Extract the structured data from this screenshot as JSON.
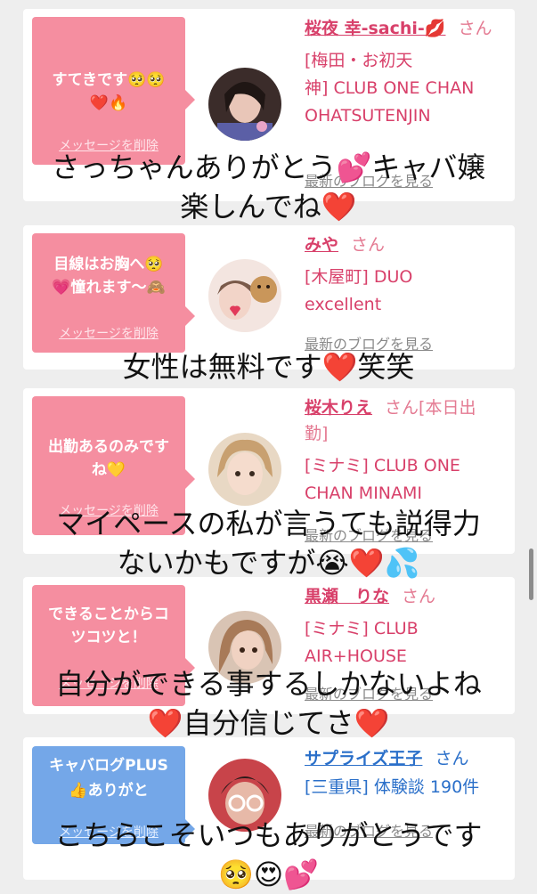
{
  "delete_label": "メッセージを削除",
  "san": "さん",
  "blog_label": "最新のブログを見る",
  "cards": [
    {
      "bubble_line1": "すてきです🥺🥺",
      "bubble_line2": "❤️🔥",
      "name": "桜夜 幸-sachi-💋",
      "name_extra": "",
      "shop_line1": "[梅田・お初天",
      "shop_line2": "神] CLUB ONE CHAN",
      "shop_line3": "OHATSUTENJIN"
    },
    {
      "bubble_line1": "目線はお胸へ🥺",
      "bubble_line2": "💗憧れます～🙈",
      "name": "みや",
      "name_extra": "",
      "shop_line1": "[木屋町] DUO",
      "shop_line2": "excellent",
      "shop_line3": ""
    },
    {
      "bubble_line1": "出勤あるのみです",
      "bubble_line2": "ね💛",
      "name": "桜木りえ",
      "name_extra": "[本日出",
      "name_extra2": "勤]",
      "shop_line1": "[ミナミ] CLUB ONE",
      "shop_line2": "CHAN MINAMI",
      "shop_line3": ""
    },
    {
      "bubble_line1": "できることからコ",
      "bubble_line2": "ツコツと！",
      "name": "黒瀬　りな",
      "name_extra": "",
      "shop_line1": "[ミナミ] CLUB",
      "shop_line2": "AIR+HOUSE",
      "shop_line3": ""
    },
    {
      "bubble_line1": "キャバログPLUS",
      "bubble_line2": "👍ありがと",
      "name": "サプライズ王子",
      "name_extra": "",
      "shop_line1": "[三重県] 体験談 190件",
      "shop_line2": "",
      "shop_line3": ""
    }
  ],
  "overlays": {
    "o1_line1": "さっちゃんありがとう💕キャバ嬢",
    "o1_line2": "楽しんでね❤️",
    "o2_line1": "女性は無料です❤️笑笑",
    "o3_line1": "マイペースの私が言うても説得力",
    "o3_line2": "ないかもですが😭❤️💦",
    "o4_line1": "自分ができる事するしかないよね",
    "o4_line2": "❤️自分信じてさ❤️",
    "o5_line1": "こちらこそいつもありがとうです",
    "o5_line2": "🥺😍💕"
  },
  "colors": {
    "pink_bubble": "#f58ea0",
    "blue_bubble": "#74a7e8",
    "pink_name": "#d8406a",
    "blue_name": "#2a6fc9"
  }
}
